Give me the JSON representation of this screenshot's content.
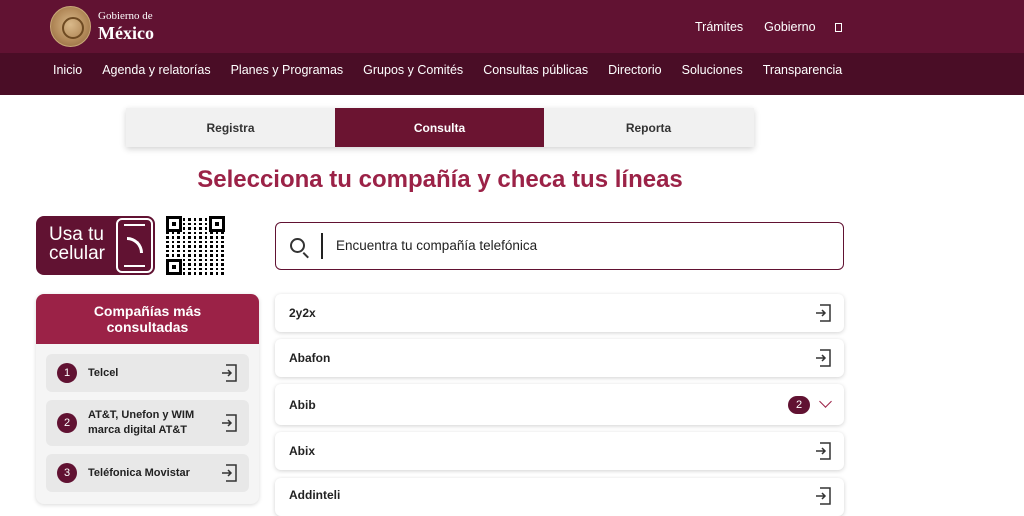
{
  "header": {
    "logo_small": "Gobierno de",
    "logo_big": "México",
    "links": [
      "Trámites",
      "Gobierno"
    ]
  },
  "nav": [
    "Inicio",
    "Agenda y relatorías",
    "Planes y Programas",
    "Grupos y Comités",
    "Consultas públicas",
    "Directorio",
    "Soluciones",
    "Transparencia"
  ],
  "tabs": [
    "Registra",
    "Consulta",
    "Reporta"
  ],
  "active_tab": "Consulta",
  "headline": "Selecciona tu compañía y checa tus líneas",
  "celular": {
    "line1": "Usa tu",
    "line2": "celular"
  },
  "top_companies": {
    "title_line1": "Compañías más",
    "title_line2": "consultadas",
    "items": [
      {
        "num": "1",
        "name_line1": "Telcel",
        "name_line2": ""
      },
      {
        "num": "2",
        "name_line1": "AT&T, Unefon y WIM",
        "name_line2": "marca digital AT&T"
      },
      {
        "num": "3",
        "name_line1": "Teléfonica Movistar",
        "name_line2": ""
      }
    ]
  },
  "search": {
    "placeholder": "Encuentra tu compañía telefónica"
  },
  "companies": [
    {
      "name": "2y2x"
    },
    {
      "name": "Abafon"
    },
    {
      "name": "Abib",
      "count": "2"
    },
    {
      "name": "Abix"
    },
    {
      "name": "Addinteli"
    }
  ],
  "colors": {
    "primary": "#611232",
    "nav": "#4a0d26",
    "accent": "#9b2247"
  }
}
